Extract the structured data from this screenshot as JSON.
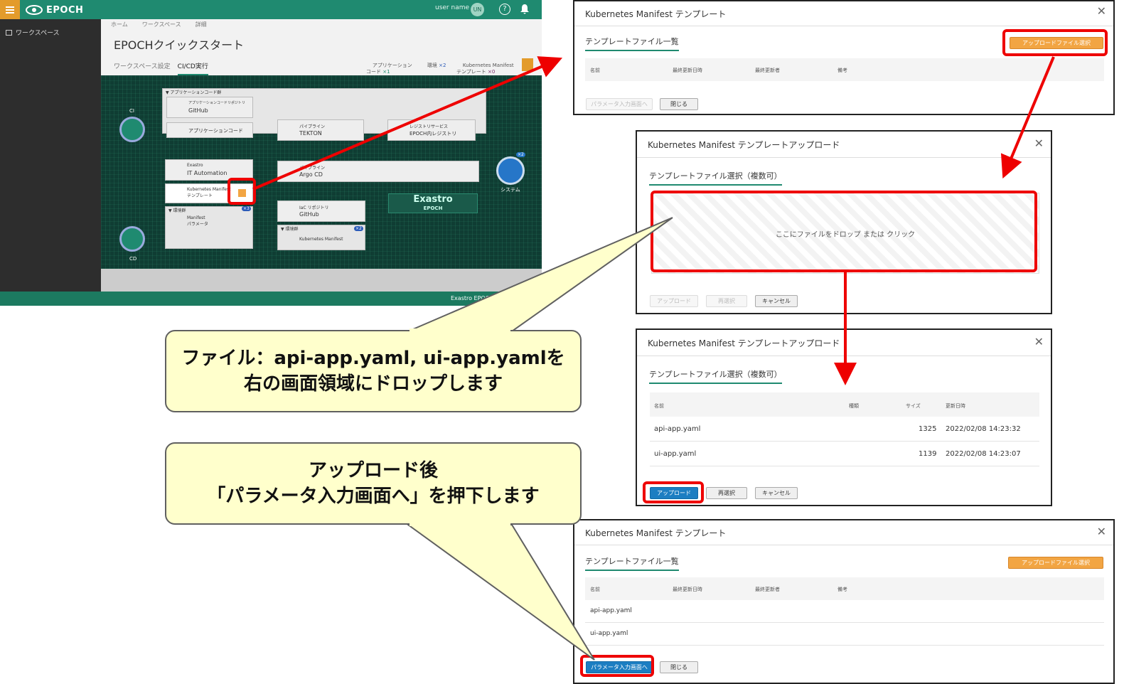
{
  "app": {
    "brand": "EPOCH",
    "user_name": "user name",
    "avatar": "UN",
    "sidebar_item": "ワークスペース",
    "breadcrumb": [
      "ホーム",
      "ワークスペース",
      "詳細"
    ],
    "page_title": "EPOCHクイックスタート",
    "tabs": [
      "ワークスペース設定",
      "CI/CD実行"
    ],
    "stats": [
      {
        "label": "アプリケーション\nコード",
        "count": "×1"
      },
      {
        "label": "環境",
        "count": "×2"
      },
      {
        "label": "Kubernetes Manifest\nテンプレート",
        "count": "×0"
      }
    ],
    "footer": "Exastro EPOCH",
    "nodes": {
      "app_group": "▼ アプリケーションコード群",
      "git_repo_sub": "アプリケーションコードリポジトリ",
      "git_repo": "GitHub",
      "app_code": "アプリケーションコード",
      "pipeline_sub": "パイプライン",
      "pipeline": "TEKTON",
      "registry_sub": "レジストリサービス",
      "registry": "EPOCH内レジストリ",
      "exastro_sub": "Exastro",
      "exastro": "IT Automation",
      "manifest_tpl": "Kubernetes Manifest\nテンプレート",
      "env_group": "▼ 環境群",
      "manifest_param": "Manifest\nパラメータ",
      "argo_sub": "パイプライン",
      "argo": "Argo CD",
      "iac_sub": "IaC リポジトリ",
      "iac": "GitHub",
      "env_group2": "▼ 環境群",
      "k8s_manifest": "Kubernetes Manifest",
      "ci": "CI",
      "cd": "CD",
      "system": "システム",
      "badge1": "×2",
      "badge2": "×3",
      "badge3": "×2",
      "logo": "Exastro",
      "logo_sub": "EPOCH"
    }
  },
  "dialog1": {
    "title": "Kubernetes Manifest テンプレート",
    "section": "テンプレートファイル一覧",
    "upload_select": "アップロードファイル選択",
    "columns": [
      "名前",
      "最終更新日時",
      "最終更新者",
      "備考"
    ],
    "param_button": "パラメータ入力画面へ",
    "close_button": "閉じる"
  },
  "dialog2": {
    "title": "Kubernetes Manifest テンプレートアップロード",
    "section": "テンプレートファイル選択（複数可）",
    "drop_text": "ここにファイルをドロップ または クリック",
    "upload": "アップロード",
    "reselect": "再選択",
    "cancel": "キャンセル"
  },
  "dialog3": {
    "title": "Kubernetes Manifest テンプレートアップロード",
    "section": "テンプレートファイル選択（複数可）",
    "columns": [
      "名前",
      "種類",
      "サイズ",
      "更新日時"
    ],
    "rows": [
      {
        "name": "api-app.yaml",
        "size": "1325",
        "date": "2022/02/08 14:23:32"
      },
      {
        "name": "ui-app.yaml",
        "size": "1139",
        "date": "2022/02/08 14:23:07"
      }
    ],
    "upload": "アップロード",
    "reselect": "再選択",
    "cancel": "キャンセル"
  },
  "dialog4": {
    "title": "Kubernetes Manifest テンプレート",
    "section": "テンプレートファイル一覧",
    "upload_select": "アップロードファイル選択",
    "columns": [
      "名前",
      "最終更新日時",
      "最終更新者",
      "備考"
    ],
    "rows": [
      "api-app.yaml",
      "ui-app.yaml"
    ],
    "param_button": "パラメータ入力画面へ",
    "close_button": "閉じる"
  },
  "callouts": {
    "drop": {
      "line1": "ファイル：api-app.yaml, ui-app.yamlを",
      "line2": "右の画面領域にドロップします"
    },
    "after": {
      "line1": "アップロード後",
      "line2": "「パラメータ入力画面へ」を押下します"
    }
  },
  "colors": {
    "accent": "#1f8a70",
    "highlight": "#ee0000",
    "callout_bg": "#ffffcc",
    "upload_btn": "#f2a543",
    "primary_btn": "#1c7ec2"
  }
}
